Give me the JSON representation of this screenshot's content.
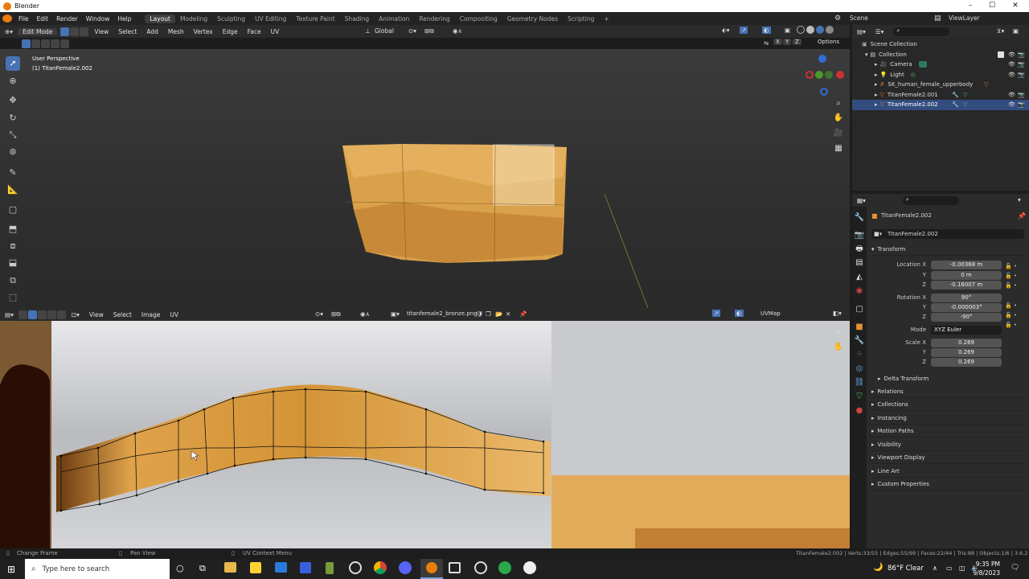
{
  "window": {
    "title": "Blender",
    "minimize": "–",
    "maximize": "☐",
    "close": "✕"
  },
  "menu": [
    "File",
    "Edit",
    "Render",
    "Window",
    "Help"
  ],
  "workspaces": [
    "Layout",
    "Modeling",
    "Sculpting",
    "UV Editing",
    "Texture Paint",
    "Shading",
    "Animation",
    "Rendering",
    "Compositing",
    "Geometry Nodes",
    "Scripting"
  ],
  "active_workspace": "Layout",
  "add_workspace": "+",
  "scene": {
    "scene_label": "Scene",
    "view_layer_label": "ViewLayer"
  },
  "viewport_header": {
    "mode": "Edit Mode",
    "menus": [
      "View",
      "Select",
      "Add",
      "Mesh",
      "Vertex",
      "Edge",
      "Face",
      "UV"
    ],
    "orientation": "Global",
    "options": "Options",
    "axis_x": "X",
    "axis_y": "Y",
    "axis_z": "Z"
  },
  "viewport": {
    "perspective": "User Perspective",
    "object": "(1) TitanFemale2.002"
  },
  "uv_header": {
    "menus": [
      "View",
      "Select",
      "Image",
      "UV"
    ],
    "image_name": "titanfemale2_bronze.png",
    "uv_map": "UVMap"
  },
  "outliner": {
    "root": "Scene Collection",
    "items": [
      {
        "label": "Collection",
        "indent": 0
      },
      {
        "label": "Camera",
        "indent": 1
      },
      {
        "label": "Light",
        "indent": 1
      },
      {
        "label": "SK_human_female_upperbody",
        "indent": 1
      },
      {
        "label": "TitanFemale2.001",
        "indent": 1
      },
      {
        "label": "TitanFemale2.002",
        "indent": 1,
        "selected": true
      }
    ]
  },
  "properties": {
    "object_name": "TitanFemale2.002",
    "object_name_field": "TitanFemale2.002",
    "transform_title": "Transform",
    "location_label": "Location X",
    "location": [
      "-0.00368 m",
      "0 m",
      "-0.16007 m"
    ],
    "rotation_label": "Rotation X",
    "rotation": [
      "90°",
      "-0.000003°",
      "-90°"
    ],
    "mode_label": "Mode",
    "mode_value": "XYZ Euler",
    "scale_label": "Scale X",
    "scale": [
      "0.269",
      "0.269",
      "0.269"
    ],
    "y_label": "Y",
    "z_label": "Z",
    "delta": "Delta Transform",
    "panels": [
      "Relations",
      "Collections",
      "Instancing",
      "Motion Paths",
      "Visibility",
      "Viewport Display",
      "Line Art",
      "Custom Properties"
    ]
  },
  "statusbar": {
    "left1": "Change Frame",
    "left2": "Pan View",
    "left3": "UV Context Menu",
    "right": "TitanFemale2.002 | Verts:33/55 | Edges:55/99 | Faces:22/44 | Tris:88 | Objects:1/6 | 3.6.2"
  },
  "taskbar": {
    "search_placeholder": "Type here to search",
    "weather": "86°F  Clear",
    "time": "9:35 PM",
    "date": "9/8/2023"
  },
  "colors": {
    "accent": "#4772b3",
    "mesh": "#d9a14a",
    "blender_orange": "#e87d0d"
  }
}
